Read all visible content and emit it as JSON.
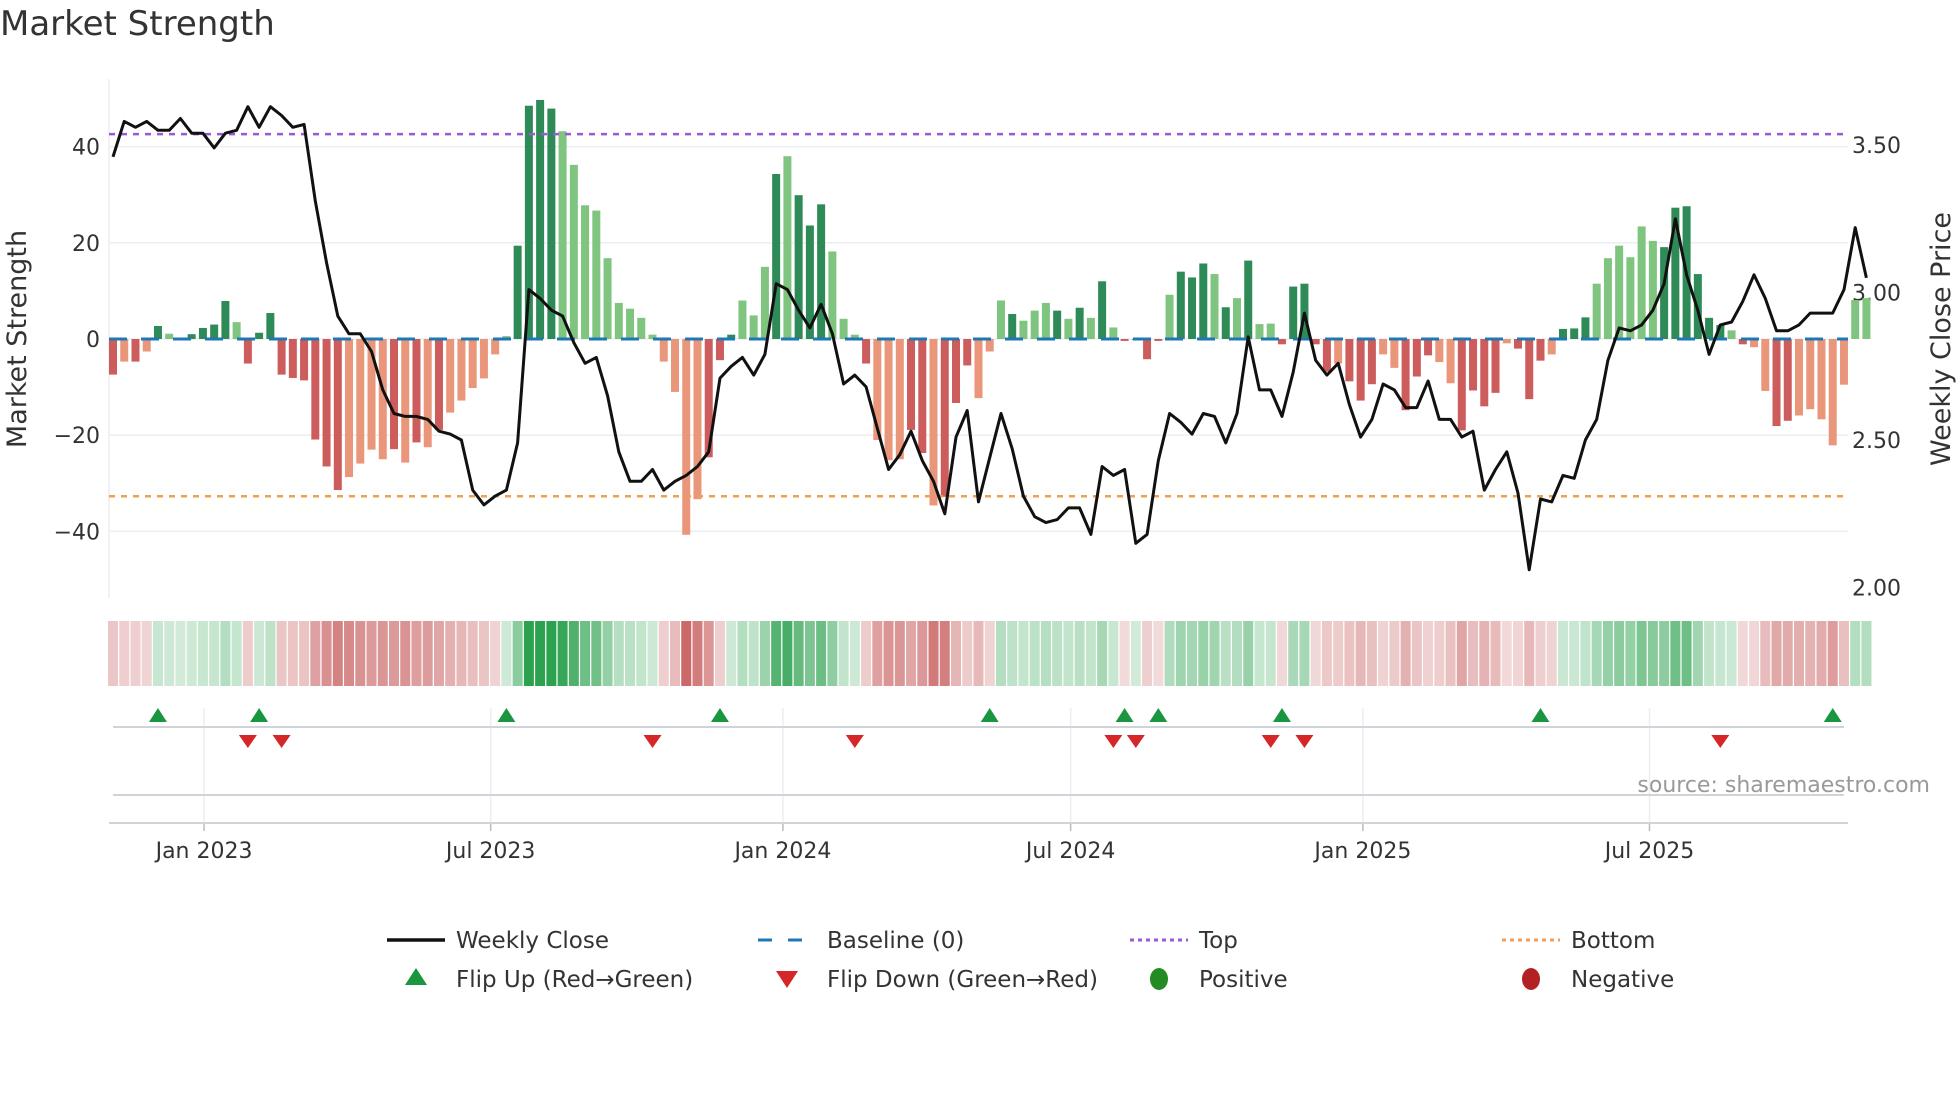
{
  "title": "Market Strength",
  "source": "source: sharemaestro.com",
  "chart_data": {
    "type": "bar+line",
    "title": "Market Strength",
    "ylabel_left": "Market Strength",
    "ylabel_right": "Weekly Close Price",
    "ylim_left": [
      -54,
      54
    ],
    "ylim_right": [
      1.93,
      3.72
    ],
    "yticks_left": [
      40,
      20,
      0,
      -20,
      -40
    ],
    "yticks_left_labels": [
      "40",
      "20",
      "0",
      "−20",
      "−40"
    ],
    "yticks_right": [
      3.5,
      3.0,
      2.5,
      2.0
    ],
    "yticks_right_labels": [
      "3.50",
      "3.00",
      "2.50",
      "2.00"
    ],
    "x_ticks": [
      {
        "label": "Jan 2023",
        "week": 8.1
      },
      {
        "label": "Jul 2023",
        "week": 33.6
      },
      {
        "label": "Jan 2024",
        "week": 59.6
      },
      {
        "label": "Jul 2024",
        "week": 85.2
      },
      {
        "label": "Jan 2025",
        "week": 111.2
      },
      {
        "label": "Jul 2025",
        "week": 136.7
      }
    ],
    "top_level": 42.6,
    "bottom_level": -32.7,
    "baseline": 0,
    "strength": [
      -7.4,
      -4.7,
      -4.7,
      -2.6,
      2.7,
      1.1,
      0,
      1.0,
      2.3,
      3.0,
      7.9,
      3.5,
      -5.1,
      1.3,
      5.4,
      -7.4,
      -8.1,
      -8.6,
      -20.9,
      -26.5,
      -31.4,
      -28.7,
      -25.9,
      -23,
      -25,
      -22.9,
      -25.7,
      -21.5,
      -22.5,
      -18.9,
      -15.3,
      -12.8,
      -10.2,
      -8.2,
      -3.2,
      0.6,
      19.4,
      48.5,
      49.7,
      47.9,
      43.2,
      36.2,
      27.8,
      26.7,
      16.8,
      7.5,
      6.3,
      4.4,
      0.9,
      -4.7,
      -11,
      -40.7,
      -33.3,
      -24.6,
      -4.4,
      0.9,
      8,
      4.9,
      15,
      34.3,
      38,
      29.9,
      23.6,
      28,
      18.2,
      4.2,
      0.9,
      -5.1,
      -21,
      -25.2,
      -25,
      -18.9,
      -23.7,
      -34.6,
      -32.8,
      -13.3,
      -5.5,
      -12.3,
      -2.6,
      8,
      5.2,
      3.8,
      5.9,
      7.5,
      5.9,
      4.2,
      6.5,
      4.4,
      12,
      2.4,
      -0.4,
      0,
      -4.2,
      -0.4,
      9.2,
      14,
      12.8,
      15.7,
      13.5,
      6.6,
      8.5,
      16.3,
      3.1,
      3.2,
      -1.1,
      10.9,
      11.5,
      -1.1,
      -6.8,
      -5.1,
      -8.8,
      -12.8,
      -9.4,
      -3.2,
      -6,
      -14.8,
      -7.8,
      -3.4,
      -4.8,
      -9.2,
      -19,
      -10.7,
      -14,
      -11.2,
      -0.9,
      -2,
      -12.5,
      -4.5,
      -3.2,
      2.1,
      2.2,
      4.5,
      11.5,
      16.8,
      19.4,
      17,
      23.4,
      20.4,
      19.1,
      27.3,
      27.6,
      13.5,
      4.4,
      2.9,
      1.8,
      -1.1,
      -1.7,
      -10.8,
      -18.1,
      -17,
      -15.9,
      -14.6,
      -16.7,
      -22.1,
      -9.5,
      8.1,
      8.5
    ],
    "shade": "dldldldddddldddddddddlllldldldllllllddddllllllllllllldddllldldddllldlllddldddllldllldldldlddddldddldldlldddddldddlldddllddddldddldddllllllddddddldlldd",
    "weekly_close": [
      3.46,
      3.58,
      3.56,
      3.58,
      3.55,
      3.55,
      3.59,
      3.54,
      3.54,
      3.49,
      3.54,
      3.55,
      3.63,
      3.56,
      3.63,
      3.6,
      3.56,
      3.57,
      3.31,
      3.1,
      2.92,
      2.86,
      2.86,
      2.8,
      2.67,
      2.59,
      2.58,
      2.58,
      2.57,
      2.53,
      2.52,
      2.5,
      2.33,
      2.28,
      2.31,
      2.33,
      2.49,
      3.01,
      2.98,
      2.94,
      2.92,
      2.83,
      2.76,
      2.78,
      2.65,
      2.46,
      2.36,
      2.36,
      2.4,
      2.33,
      2.36,
      2.38,
      2.41,
      2.46,
      2.71,
      2.75,
      2.78,
      2.72,
      2.79,
      3.03,
      3.01,
      2.94,
      2.88,
      2.96,
      2.86,
      2.69,
      2.72,
      2.68,
      2.54,
      2.4,
      2.45,
      2.53,
      2.43,
      2.36,
      2.25,
      2.51,
      2.6,
      2.29,
      2.44,
      2.59,
      2.47,
      2.31,
      2.24,
      2.22,
      2.23,
      2.27,
      2.27,
      2.18,
      2.41,
      2.38,
      2.4,
      2.15,
      2.18,
      2.43,
      2.59,
      2.56,
      2.52,
      2.59,
      2.58,
      2.49,
      2.59,
      2.85,
      2.67,
      2.67,
      2.58,
      2.73,
      2.93,
      2.77,
      2.72,
      2.76,
      2.62,
      2.51,
      2.57,
      2.69,
      2.67,
      2.61,
      2.61,
      2.7,
      2.57,
      2.57,
      2.51,
      2.53,
      2.33,
      2.4,
      2.46,
      2.32,
      2.06,
      2.3,
      2.29,
      2.38,
      2.37,
      2.5,
      2.57,
      2.77,
      2.88,
      2.87,
      2.89,
      2.94,
      3.03,
      3.25,
      3.06,
      2.94,
      2.79,
      2.89,
      2.9,
      2.97,
      3.06,
      2.98,
      2.87,
      2.87,
      2.89,
      2.93,
      2.93,
      2.93,
      3.01,
      3.22,
      3.05
    ],
    "flip_up_weeks": [
      4,
      13,
      35,
      54,
      78,
      90,
      93,
      104,
      127,
      153
    ],
    "flip_down_weeks": [
      12,
      15,
      48,
      66,
      89,
      91,
      103,
      106,
      143
    ],
    "colors": {
      "positive_dark": "#2e8b57",
      "positive_light": "#7fc47f",
      "negative_dark": "#cd5c5c",
      "negative_light": "#e9967a",
      "line": "#111111",
      "baseline": "#1f77b4",
      "top": "#9b59d6",
      "bottom": "#f0a050",
      "flip_up": "#1a9641",
      "flip_down": "#d62728",
      "positive_dot": "#228b22",
      "negative_dot": "#b22222"
    },
    "legend": [
      {
        "label": "Weekly Close",
        "symbol": "line"
      },
      {
        "label": "Baseline (0)",
        "symbol": "dash"
      },
      {
        "label": "Top",
        "symbol": "dot-purple"
      },
      {
        "label": "Bottom",
        "symbol": "dot-orange"
      },
      {
        "label": "Flip Up (Red→Green)",
        "symbol": "tri-up"
      },
      {
        "label": "Flip Down (Green→Red)",
        "symbol": "tri-down"
      },
      {
        "label": "Positive",
        "symbol": "dot-green"
      },
      {
        "label": "Negative",
        "symbol": "dot-red"
      }
    ],
    "legend_placement": "bottom"
  }
}
